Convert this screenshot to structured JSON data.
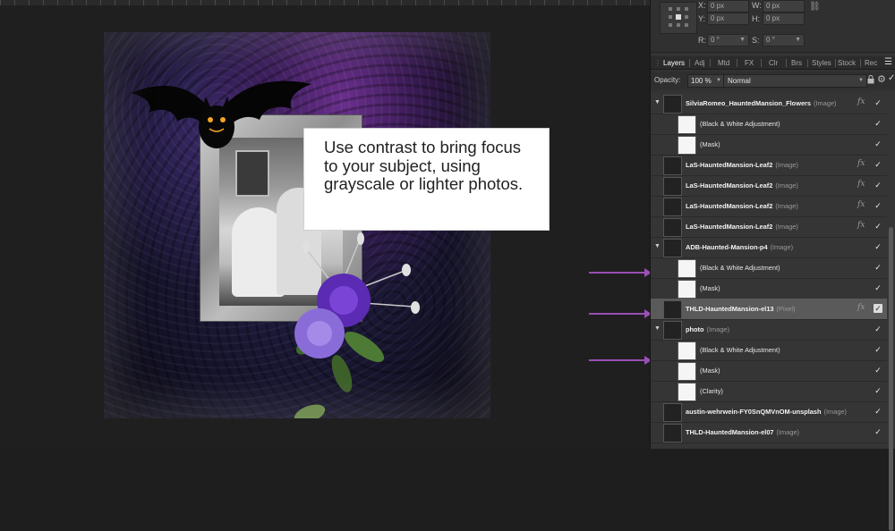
{
  "canvas": {
    "callout_text": "Use contrast to bring focus to your subject, using grayscale or lighter photos."
  },
  "transform": {
    "x_label": "X:",
    "x_value": "0 px",
    "y_label": "Y:",
    "y_value": "0 px",
    "w_label": "W:",
    "w_value": "0 px",
    "h_label": "H:",
    "h_value": "0 px",
    "r_label": "R:",
    "r_value": "0 °",
    "s_label": "S:",
    "s_value": "0 °"
  },
  "tabs": [
    {
      "label": "Layers",
      "active": true
    },
    {
      "label": "Adj"
    },
    {
      "label": "Mtd"
    },
    {
      "label": "FX"
    },
    {
      "label": "Clr"
    },
    {
      "label": "Brs"
    },
    {
      "label": "Styles"
    },
    {
      "label": "Stock"
    },
    {
      "label": "Rec"
    }
  ],
  "toolbar": {
    "opacity_label": "Opacity:",
    "opacity_value": "100 %",
    "blend_mode": "Normal"
  },
  "layers": [
    {
      "name": "SilviaRomeo_HauntedMansion_Flowers",
      "kind": "(Image)",
      "disclosure": "▼",
      "fx": "fx",
      "level": 0
    },
    {
      "name": "(Black & White Adjustment)",
      "level": 1
    },
    {
      "name": "(Mask)",
      "level": 1
    },
    {
      "name": "LaS-HauntedMansion-Leaf2",
      "kind": "(Image)",
      "fx": "fx",
      "level": 0
    },
    {
      "name": "LaS-HauntedMansion-Leaf2",
      "kind": "(Image)",
      "fx": "fx",
      "level": 0
    },
    {
      "name": "LaS-HauntedMansion-Leaf2",
      "kind": "(Image)",
      "fx": "fx",
      "level": 0
    },
    {
      "name": "LaS-HauntedMansion-Leaf2",
      "kind": "(Image)",
      "fx": "fx",
      "level": 0
    },
    {
      "name": "ADB-Haunted-Mansion-p4",
      "kind": "(Image)",
      "disclosure": "▼",
      "level": 0
    },
    {
      "name": "(Black & White Adjustment)",
      "level": 1
    },
    {
      "name": "(Mask)",
      "level": 1
    },
    {
      "name": "THLD-HauntedMansion-el13",
      "kind": "(Pixel)",
      "fx": "fx",
      "level": 0,
      "selected": true
    },
    {
      "name": "photo",
      "kind": "(Image)",
      "disclosure": "▼",
      "level": 0
    },
    {
      "name": "(Black & White Adjustment)",
      "level": 1
    },
    {
      "name": "(Mask)",
      "level": 1
    },
    {
      "name": "(Clarity)",
      "level": 1
    },
    {
      "name": "austin-wehrwein-FY0SnQMVnOM-unsplash",
      "kind": "(Image)",
      "level": 0
    },
    {
      "name": "THLD-HauntedMansion-el07",
      "kind": "(Image)",
      "level": 0
    }
  ],
  "colors": {
    "annotation_arrow": "#9a4fb6",
    "panel_bg": "#333333",
    "selected_row": "#5a5a5a"
  }
}
